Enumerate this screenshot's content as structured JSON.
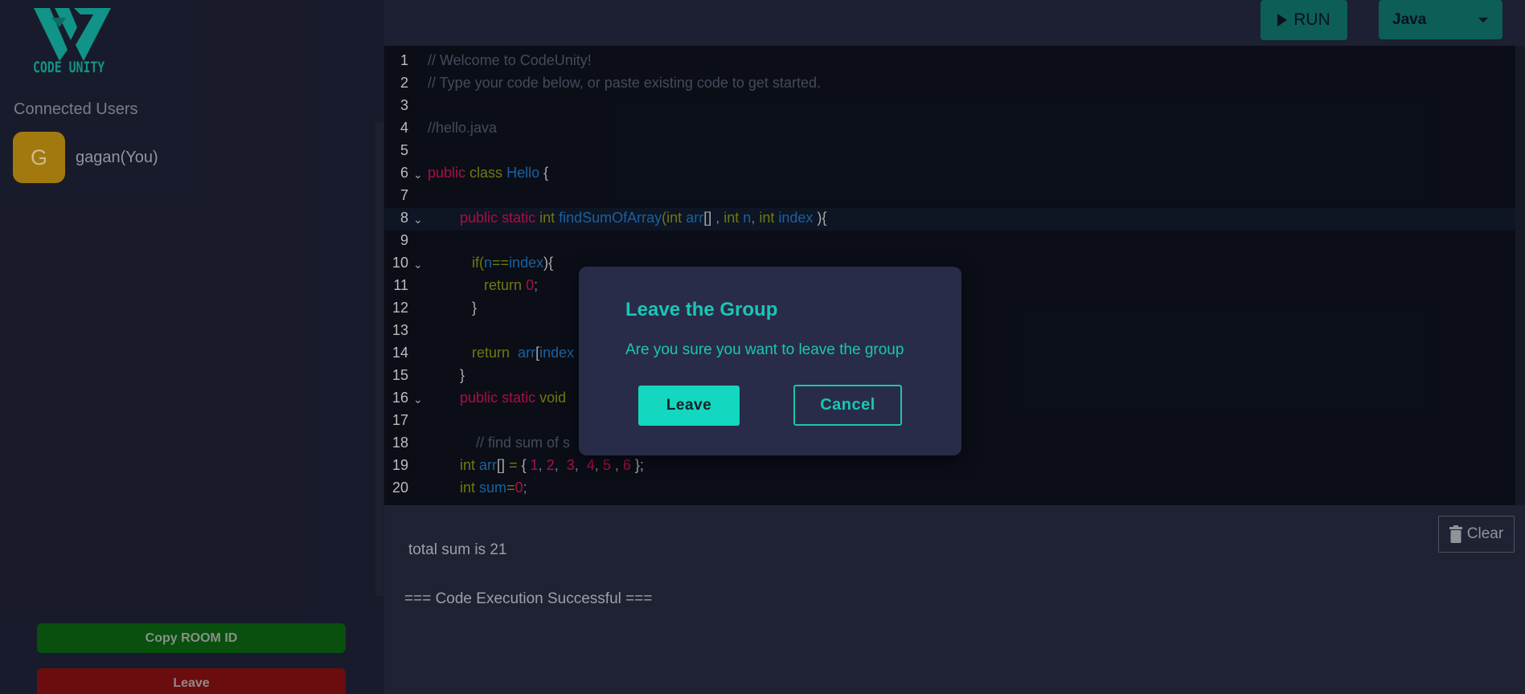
{
  "app": {
    "logo_text": "CODE UNITY",
    "accent_color": "#19c6b4"
  },
  "sidebar": {
    "connected_title": "Connected Users",
    "users": [
      {
        "initial": "G",
        "name": "gagan(You)",
        "avatar_color": "#b98a12"
      }
    ],
    "copy_room_label": "Copy ROOM ID",
    "leave_label": "Leave"
  },
  "toolbar": {
    "run_label": "RUN",
    "run_icon": "play-icon",
    "language": "Java"
  },
  "editor": {
    "line_numbers": [
      "1",
      "2",
      "3",
      "4",
      "5",
      "6",
      "7",
      "8",
      "9",
      "10",
      "11",
      "12",
      "13",
      "14",
      "15",
      "16",
      "17",
      "18",
      "19",
      "20"
    ],
    "active_line": 8,
    "folded_lines": [
      6,
      8,
      10,
      16
    ],
    "line1": "// Welcome to CodeUnity!",
    "line2": "// Type your code below, or paste existing code to get started.",
    "line4": "//hello.java",
    "line18": "// find sum of s"
  },
  "output": {
    "result": "total sum is 21",
    "status": "=== Code Execution Successful ===",
    "clear_label": "Clear",
    "clear_icon": "trash-icon"
  },
  "dialog": {
    "title": "Leave the Group",
    "message": "Are you sure you want to leave the group",
    "confirm_label": "Leave",
    "cancel_label": "Cancel"
  }
}
